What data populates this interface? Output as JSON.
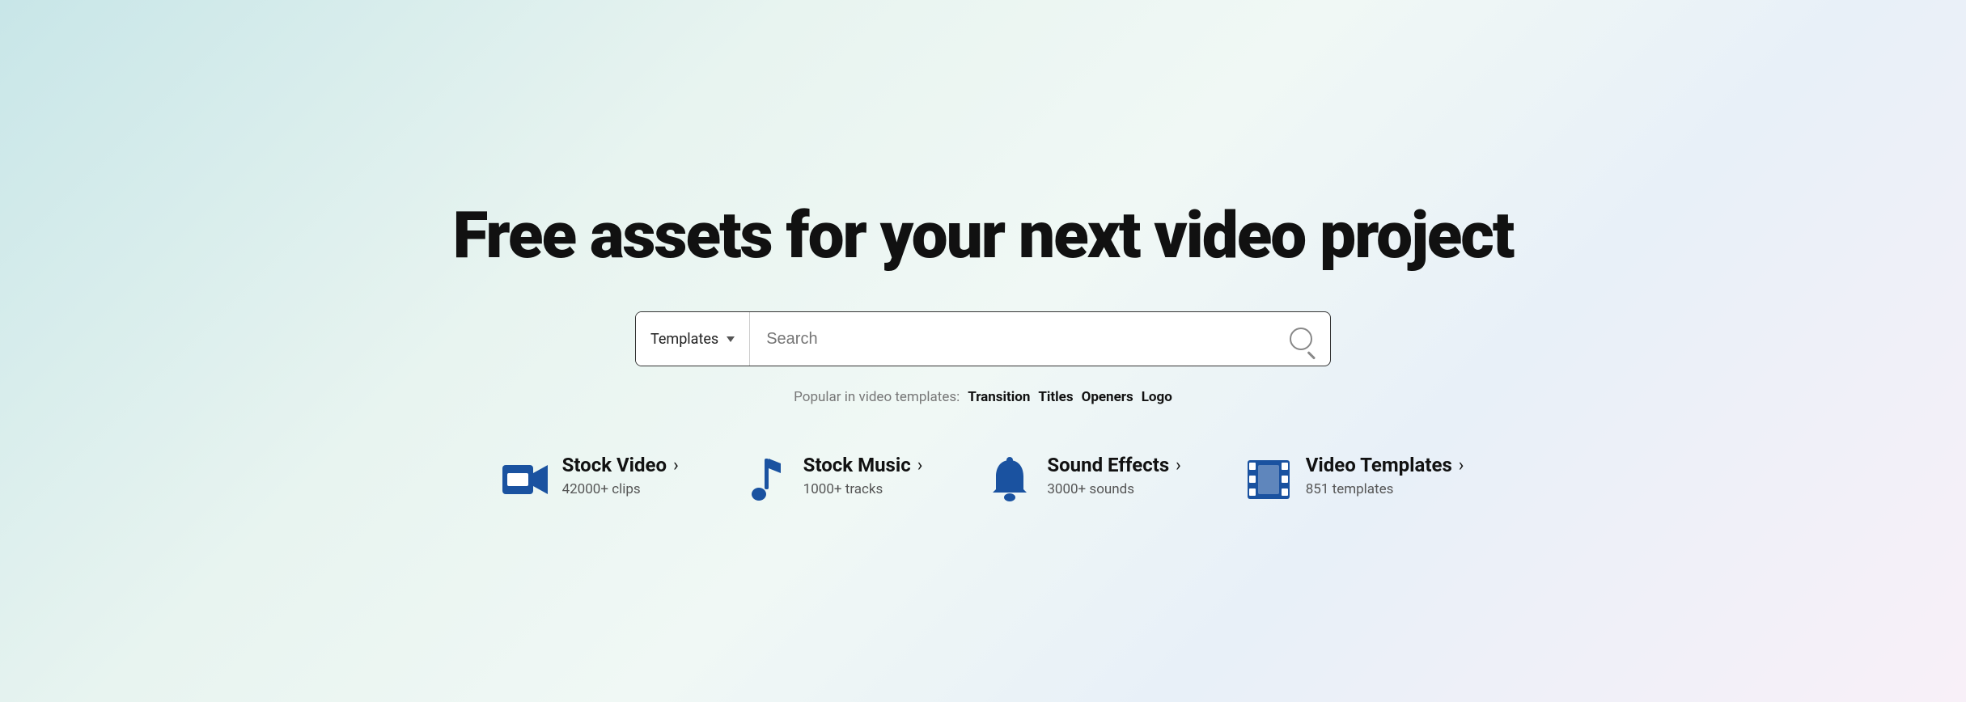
{
  "hero": {
    "title": "Free assets for your next video project",
    "search": {
      "dropdown_label": "Templates",
      "placeholder": "Search",
      "button_label": "search"
    },
    "popular": {
      "label": "Popular in video templates:",
      "tags": [
        "Transition",
        "Titles",
        "Openers",
        "Logo"
      ]
    }
  },
  "categories": [
    {
      "id": "stock-video",
      "title": "Stock Video",
      "count": "42000+ clips",
      "icon": "video-icon"
    },
    {
      "id": "stock-music",
      "title": "Stock Music",
      "count": "1000+ tracks",
      "icon": "music-icon"
    },
    {
      "id": "sound-effects",
      "title": "Sound Effects",
      "count": "3000+ sounds",
      "icon": "bell-icon"
    },
    {
      "id": "video-templates",
      "title": "Video Templates",
      "count": "851 templates",
      "icon": "film-icon"
    }
  ],
  "colors": {
    "accent_blue": "#1a52a0",
    "text_dark": "#111111",
    "text_gray": "#777777",
    "border": "#333333"
  }
}
